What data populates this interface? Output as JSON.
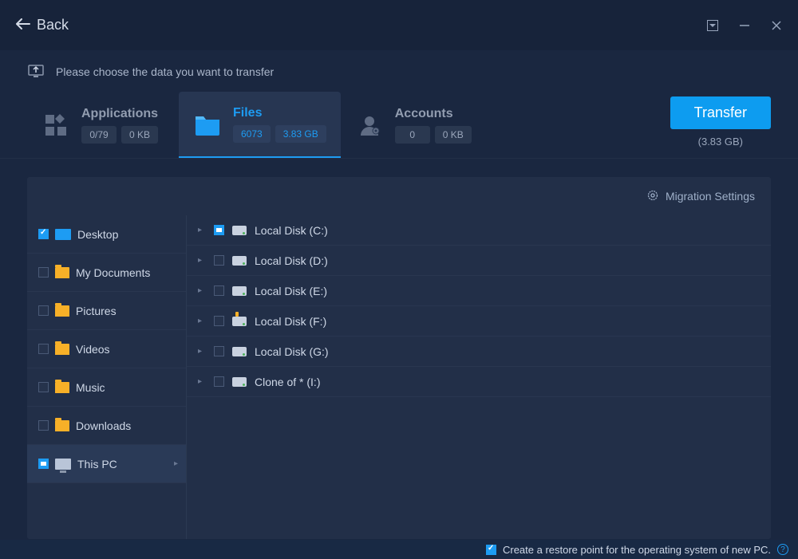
{
  "titlebar": {
    "back": "Back"
  },
  "instruction": "Please choose the data you want to transfer",
  "tabs": {
    "applications": {
      "title": "Applications",
      "count": "0/79",
      "size": "0 KB"
    },
    "files": {
      "title": "Files",
      "count": "6073",
      "size": "3.83 GB"
    },
    "accounts": {
      "title": "Accounts",
      "count": "0",
      "size": "0 KB"
    }
  },
  "transfer": {
    "label": "Transfer",
    "size": "(3.83 GB)"
  },
  "panel": {
    "settings_label": "Migration Settings"
  },
  "sidebar": {
    "items": [
      {
        "label": "Desktop"
      },
      {
        "label": "My Documents"
      },
      {
        "label": "Pictures"
      },
      {
        "label": "Videos"
      },
      {
        "label": "Music"
      },
      {
        "label": "Downloads"
      },
      {
        "label": "This PC"
      }
    ]
  },
  "disks": [
    {
      "label": "Local Disk (C:)"
    },
    {
      "label": "Local Disk (D:)"
    },
    {
      "label": "Local Disk (E:)"
    },
    {
      "label": "Local Disk (F:)"
    },
    {
      "label": "Local Disk (G:)"
    },
    {
      "label": "Clone of * (I:)"
    }
  ],
  "footer": {
    "restore_label": "Create a restore point for the operating system of new PC."
  }
}
